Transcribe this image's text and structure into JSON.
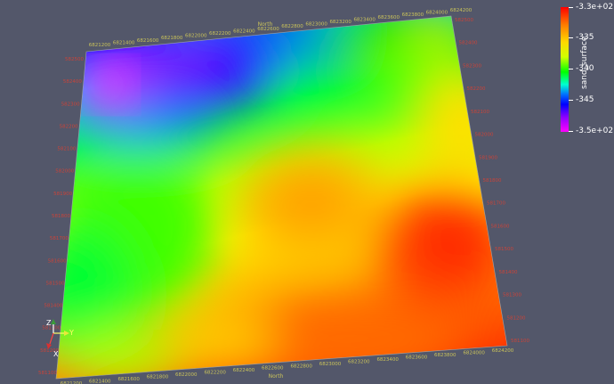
{
  "viewport": {
    "background": "#53576a"
  },
  "scalar_bar": {
    "title": "sand_surface",
    "max_label": "-3.3e+02",
    "min_label": "-3.5e+02",
    "labels": [
      "-335",
      "-340",
      "-345"
    ],
    "colors": [
      "#ff0000",
      "#ffd800",
      "#00ff00",
      "#00ffd0",
      "#0000ff",
      "#ff00ff"
    ]
  },
  "grid_axes": {
    "top_title": "North",
    "bottom_title": "North",
    "top_ticks": [
      "6821200",
      "6821400",
      "6821600",
      "6821800",
      "6822000",
      "6822200",
      "6822400",
      "6822600",
      "6822800",
      "6823000",
      "6823200",
      "6823400",
      "6823600",
      "6823800",
      "6824000",
      "6824200"
    ],
    "bottom_ticks": [
      "6821200",
      "6821400",
      "6821600",
      "6821800",
      "6822000",
      "6822200",
      "6822400",
      "6822600",
      "6822800",
      "6823000",
      "6823200",
      "6823400",
      "6823600",
      "6823800",
      "6824000",
      "6824200"
    ],
    "left_ticks": [
      "582500",
      "582400",
      "582300",
      "582200",
      "582100",
      "582000",
      "581900",
      "581800",
      "581700",
      "581600",
      "581500",
      "581400",
      "581300",
      "581200",
      "581100"
    ],
    "right_ticks": [
      "582500",
      "582400",
      "582300",
      "582200",
      "582100",
      "582000",
      "581900",
      "581800",
      "581700",
      "581600",
      "581500",
      "581400",
      "581300",
      "581200",
      "581100"
    ]
  },
  "orientation_axes": {
    "x": "X",
    "y": "Y",
    "z": "Z"
  }
}
